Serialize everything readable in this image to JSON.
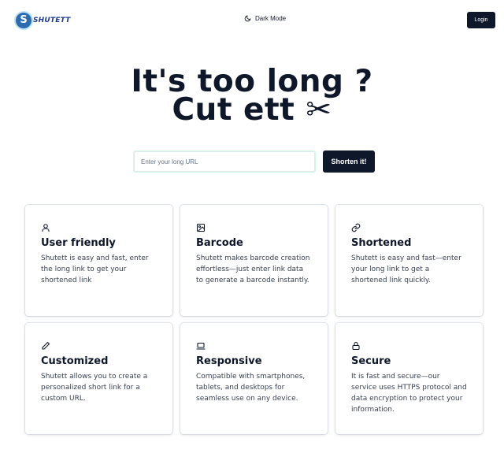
{
  "header": {
    "logo_letter": "S",
    "logo_text": "SHUTETT",
    "dark_mode_label": "Dark Mode",
    "login_label": "Login"
  },
  "hero": {
    "line1": "It's too long ?",
    "line2": "Cut ett ✂"
  },
  "shorten": {
    "placeholder": "Enter your long URL",
    "value": "",
    "button_label": "Shorten it!"
  },
  "features": [
    {
      "icon": "user-icon",
      "title": "User friendly",
      "text": "Shutett is easy and fast, enter the long link to get your shortened link"
    },
    {
      "icon": "image-icon",
      "title": "Barcode",
      "text": "Shutett makes barcode creation effortless—just enter link data to generate a barcode instantly."
    },
    {
      "icon": "link-icon",
      "title": "Shortened",
      "text": "Shutett is easy and fast—enter your long link to get a shortened link quickly."
    },
    {
      "icon": "pencil-icon",
      "title": "Customized",
      "text": "Shutett allows you to create a personalized short link for a custom URL."
    },
    {
      "icon": "laptop-icon",
      "title": "Responsive",
      "text": "Compatible with smartphones, tablets, and desktops for seamless use on any device."
    },
    {
      "icon": "lock-icon",
      "title": "Secure",
      "text": "It is fast and secure—our service uses HTTPS protocol and data encryption to protect your information."
    }
  ]
}
